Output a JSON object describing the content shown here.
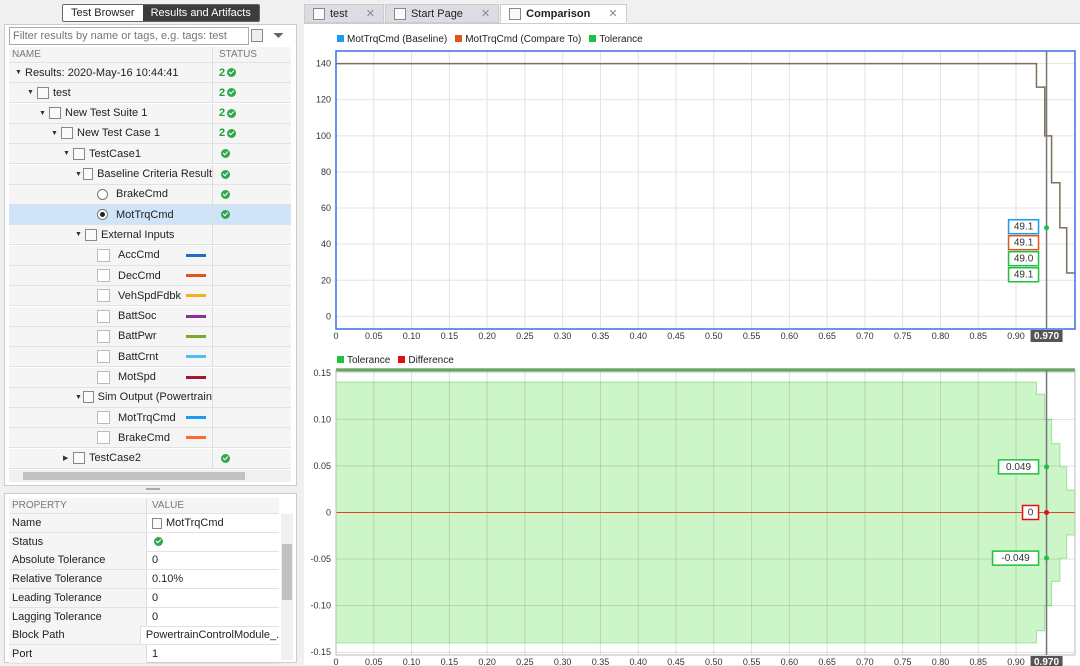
{
  "left": {
    "tabs": [
      "Test Browser",
      "Results and Artifacts"
    ],
    "filter_placeholder": "Filter results by name or tags, e.g. tags: test",
    "columns": [
      "NAME",
      "STATUS"
    ],
    "tree": [
      {
        "label": "Results: 2020-May-16 10:44:41",
        "level": 0,
        "expander": "down",
        "icon": "none",
        "status": "2",
        "pass": true
      },
      {
        "label": "test",
        "level": 1,
        "expander": "down",
        "icon": "test-file-icon",
        "status": "2",
        "pass": true
      },
      {
        "label": "New Test Suite 1",
        "level": 2,
        "expander": "down",
        "icon": "folder-icon",
        "status": "2",
        "pass": true
      },
      {
        "label": "New Test Case 1",
        "level": 3,
        "expander": "down",
        "icon": "document-icon",
        "status": "2",
        "pass": true
      },
      {
        "label": "TestCase1",
        "level": 4,
        "expander": "down",
        "icon": "test-case-icon",
        "status": "",
        "pass": true
      },
      {
        "label": "Baseline Criteria Result",
        "level": 5,
        "expander": "down",
        "icon": "baseline-icon",
        "status": "",
        "pass": true
      },
      {
        "label": "BrakeCmd",
        "level": 6,
        "control": "radio",
        "checked": false,
        "status": "",
        "pass": true
      },
      {
        "label": "MotTrqCmd",
        "level": 6,
        "control": "radio",
        "checked": true,
        "selected": true,
        "status": "",
        "pass": true
      },
      {
        "label": "External Inputs",
        "level": 5,
        "expander": "down",
        "icon": "signal-icon",
        "status": "",
        "pass": false
      },
      {
        "label": "AccCmd",
        "level": 6,
        "control": "checkbox",
        "color": "#1f6fbf"
      },
      {
        "label": "DecCmd",
        "level": 6,
        "control": "checkbox",
        "color": "#e0541f"
      },
      {
        "label": "VehSpdFdbk",
        "level": 6,
        "control": "checkbox",
        "color": "#f0b020"
      },
      {
        "label": "BattSoc",
        "level": 6,
        "control": "checkbox",
        "color": "#8a2f9a"
      },
      {
        "label": "BattPwr",
        "level": 6,
        "control": "checkbox",
        "color": "#77ac30"
      },
      {
        "label": "BattCrnt",
        "level": 6,
        "control": "checkbox",
        "color": "#4dbeee"
      },
      {
        "label": "MotSpd",
        "level": 6,
        "control": "checkbox",
        "color": "#a2142f"
      },
      {
        "label": "Sim Output (Powertrain",
        "level": 5,
        "expander": "down",
        "icon": "signal-icon",
        "status": "",
        "pass": false
      },
      {
        "label": "MotTrqCmd",
        "level": 6,
        "control": "checkbox",
        "color": "#1a9af0"
      },
      {
        "label": "BrakeCmd",
        "level": 6,
        "control": "checkbox",
        "color": "#ff6a30"
      },
      {
        "label": "TestCase2",
        "level": 4,
        "expander": "right",
        "icon": "test-case-icon",
        "status": "",
        "pass": true
      }
    ],
    "properties": {
      "columns": [
        "PROPERTY",
        "VALUE"
      ],
      "rows": [
        {
          "k": "Name",
          "v": "MotTrqCmd"
        },
        {
          "k": "Status",
          "v": ""
        },
        {
          "k": "Absolute Tolerance",
          "v": "0"
        },
        {
          "k": "Relative Tolerance",
          "v": "0.10%"
        },
        {
          "k": "Leading Tolerance",
          "v": "0"
        },
        {
          "k": "Lagging Tolerance",
          "v": "0"
        },
        {
          "k": "Block Path",
          "v": "PowertrainControlModule_..."
        },
        {
          "k": "Port",
          "v": "1"
        }
      ]
    }
  },
  "tabs": [
    {
      "label": "test",
      "active": false
    },
    {
      "label": "Start Page",
      "active": false
    },
    {
      "label": "Comparison",
      "active": true
    }
  ],
  "chart_data": [
    {
      "type": "line",
      "legend": [
        "MotTrqCmd (Baseline)",
        "MotTrqCmd (Compare To)",
        "Tolerance"
      ],
      "legend_colors": [
        "#1a9af0",
        "#e0541f",
        "#20c040"
      ],
      "legend_placement": "top-left",
      "xlim": [
        0,
        0.978
      ],
      "ylim": [
        -7,
        147
      ],
      "yticks": [
        0,
        20,
        40,
        60,
        80,
        100,
        120,
        140
      ],
      "xticks": [
        0,
        0.05,
        0.1,
        0.15,
        0.2,
        0.25,
        0.3,
        0.35,
        0.4,
        0.45,
        0.5,
        0.55,
        0.6,
        0.65,
        0.7,
        0.75,
        0.8,
        0.85,
        0.9
      ],
      "xtick_labels": [
        "0",
        "0.05",
        "0.10",
        "0.15",
        "0.20",
        "0.25",
        "0.30",
        "0.35",
        "0.40",
        "0.45",
        "0.50",
        "0.55",
        "0.60",
        "0.65",
        "0.70",
        "0.75",
        "0.80",
        "0.85",
        "0.90"
      ],
      "grid": true,
      "line_color": "#7f6f58",
      "step_x": [
        0,
        0.927,
        0.938,
        0.947,
        0.958,
        0.967,
        0.978
      ],
      "step_y": [
        140,
        127,
        100,
        74,
        49.1,
        24,
        24
      ],
      "cursor": {
        "label": "0.970",
        "readouts": [
          {
            "v": "49.1",
            "color": "#1a9af0"
          },
          {
            "v": "49.1",
            "color": "#e0541f"
          },
          {
            "v": "49.0",
            "color": "#20c040"
          },
          {
            "v": "49.1",
            "color": "#20c040"
          }
        ]
      }
    },
    {
      "type": "area",
      "legend": [
        "Tolerance",
        "Difference"
      ],
      "legend_colors": [
        "#20c040",
        "#e01010"
      ],
      "legend_placement": "top-left",
      "xlim": [
        0,
        0.978
      ],
      "ylim": [
        -0.153,
        0.153
      ],
      "yticks": [
        -0.15,
        -0.1,
        -0.05,
        0,
        0.05,
        0.1,
        0.15
      ],
      "ytick_labels": [
        "-0.15",
        "-0.10",
        "-0.05",
        "0",
        "0.05",
        "0.10",
        "0.15"
      ],
      "xticks": [
        0,
        0.05,
        0.1,
        0.15,
        0.2,
        0.25,
        0.3,
        0.35,
        0.4,
        0.45,
        0.5,
        0.55,
        0.6,
        0.65,
        0.7,
        0.75,
        0.8,
        0.85,
        0.9
      ],
      "xtick_labels": [
        "0",
        "0.05",
        "0.10",
        "0.15",
        "0.20",
        "0.25",
        "0.30",
        "0.35",
        "0.40",
        "0.45",
        "0.50",
        "0.55",
        "0.60",
        "0.65",
        "0.70",
        "0.75",
        "0.80",
        "0.85",
        "0.90"
      ],
      "grid": true,
      "tolerance_x": [
        0,
        0.927,
        0.938,
        0.947,
        0.958,
        0.967,
        0.978
      ],
      "tolerance_y": [
        0.14,
        0.127,
        0.1,
        0.074,
        0.049,
        0.024,
        0.024
      ],
      "difference": 0,
      "cursor": {
        "label": "0.970",
        "readouts": [
          {
            "v": "0.049",
            "color": "#20c040"
          },
          {
            "v": "0",
            "color": "#e01010"
          },
          {
            "v": "-0.049",
            "color": "#20c040"
          }
        ]
      }
    }
  ]
}
